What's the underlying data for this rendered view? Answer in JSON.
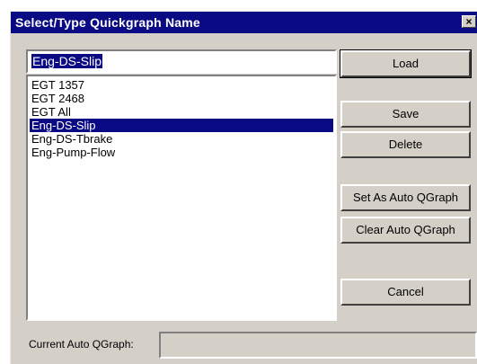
{
  "dialog": {
    "title": "Select/Type Quickgraph Name",
    "close_glyph": "×"
  },
  "name_input": {
    "value": "Eng-DS-Slip"
  },
  "list": {
    "items": [
      {
        "label": "EGT 1357"
      },
      {
        "label": "EGT 2468"
      },
      {
        "label": "EGT All"
      },
      {
        "label": "Eng-DS-Slip"
      },
      {
        "label": "Eng-DS-Tbrake"
      },
      {
        "label": "Eng-Pump-Flow"
      }
    ],
    "selected_index": 3
  },
  "buttons": {
    "load": "Load",
    "save": "Save",
    "delete": "Delete",
    "set_auto": "Set As Auto QGraph",
    "clear_auto": "Clear Auto QGraph",
    "cancel": "Cancel"
  },
  "status": {
    "label": "Current Auto QGraph:",
    "value": ""
  },
  "colors": {
    "title_bar": "#0a0a84",
    "selection": "#0a0a84",
    "face": "#d4d0c8"
  }
}
